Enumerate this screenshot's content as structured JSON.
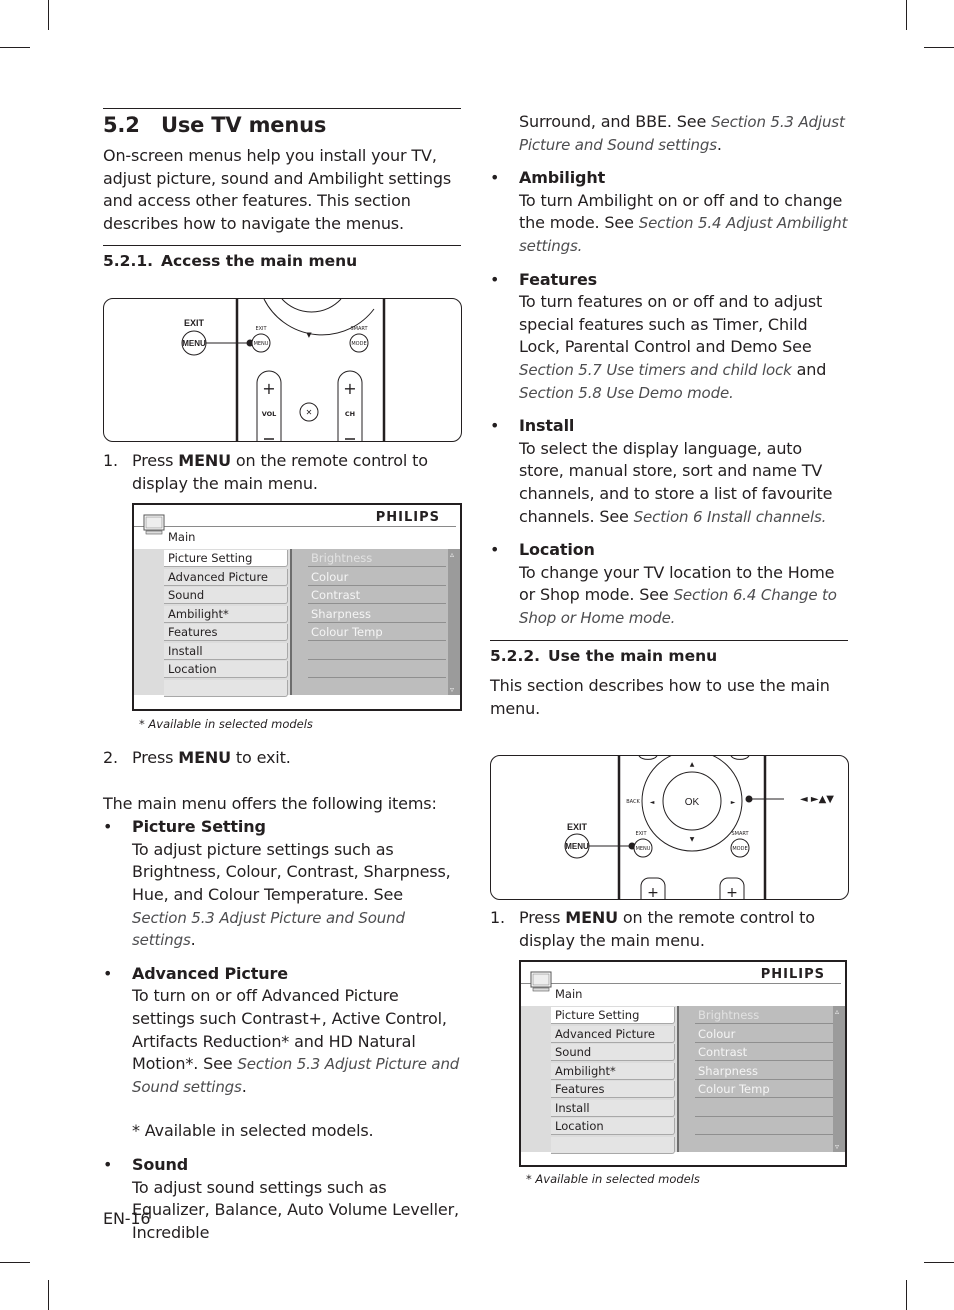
{
  "page": {
    "page_number": "EN-16"
  },
  "left_column": {
    "section_number": "5.2",
    "section_title": "Use TV menus",
    "intro": "On-screen menus help you install your TV, adjust picture, sound and Ambilight settings and access other features. This section describes how to navigate the menus.",
    "subsection_number": "5.2.1.",
    "subsection_title": "Access the main menu",
    "remote1": {
      "exit_label": "EXIT",
      "menu_label": "MENU",
      "small_exit": "EXIT",
      "small_menu": "MENU",
      "smart_label": "SMART",
      "mode_label": "MODE",
      "vol_label": "VOL",
      "ch_label": "CH",
      "plus": "+",
      "minus": "−"
    },
    "step1": {
      "num": "1.",
      "pre": "Press ",
      "key": "MENU",
      "post": " on the remote control to display the main menu."
    },
    "step2": {
      "num": "2.",
      "pre": "Press ",
      "key": "MENU",
      "post": " to exit."
    },
    "offers_intro": "The main menu offers the following items:",
    "items": [
      {
        "title": "Picture Setting",
        "text": "To adjust picture settings such as Brightness, Colour, Contrast, Sharpness, Hue, and Colour Temperature. See ",
        "ref": "Section 5.3 Adjust Picture and Sound settings",
        "tail": "."
      },
      {
        "title": "Advanced Picture",
        "text": "To turn on or off Advanced Picture settings such Contrast+, Active Control, Artifacts Reduction* and HD Natural Motion*. See ",
        "ref": "Section 5.3 Adjust Picture and Sound settings",
        "tail": ".",
        "note": "* Available in selected models."
      },
      {
        "title": "Sound",
        "text": "To adjust sound settings such as Equalizer, Balance, Auto Volume Leveller, Incredible"
      }
    ]
  },
  "right_column": {
    "sound_cont": "Surround, and BBE. See ",
    "sound_ref": "Section 5.3 Adjust Picture and Sound settings",
    "sound_tail": ".",
    "items": [
      {
        "title": "Ambilight",
        "text": "To turn Ambilight on or off and to change the mode. See ",
        "ref": "Section 5.4 Adjust Ambilight settings."
      },
      {
        "title": "Features",
        "text": "To turn features on or off and to adjust special features such as Timer, Child Lock, Parental Control and Demo See ",
        "ref": "Section 5.7 Use timers and child lock",
        "mid": " and ",
        "ref2": "Section 5.8 Use Demo mode."
      },
      {
        "title": "Install",
        "text": "To select the display language, auto store, manual store, sort and name TV channels, and to store a list of favourite channels. See ",
        "ref": "Section 6 Install channels."
      },
      {
        "title": "Location",
        "text": "To change your TV location to the Home or Shop mode. See ",
        "ref": "Section 6.4 Change to Shop or Home mode."
      }
    ],
    "subsection_number": "5.2.2.",
    "subsection_title": "Use the main menu",
    "intro": "This section describes how to use the main menu.",
    "remote2": {
      "exit_label": "EXIT",
      "menu_label": "MENU",
      "small_exit": "EXIT",
      "small_menu": "MENU",
      "smart_label": "SMART",
      "mode_label": "MODE",
      "back_label": "BACK",
      "ok_label": "OK",
      "arrows_label": "◄ ►▲▼",
      "plus": "+"
    },
    "step1": {
      "num": "1.",
      "pre": "Press ",
      "key": "MENU",
      "post": " on the remote control to display the main menu."
    }
  },
  "tv_menu": {
    "brand": "PHILIPS",
    "title": "Main",
    "left_items": [
      "Picture Setting",
      "Advanced Picture",
      "Sound",
      "Ambilight*",
      "Features",
      "Install",
      "Location",
      ""
    ],
    "selected_index": 0,
    "right_items": [
      "Brightness",
      "Colour",
      "Contrast",
      "Sharpness",
      "Colour Temp",
      "",
      "",
      ""
    ],
    "scroll_up": "▵",
    "scroll_down": "▿",
    "footnote": "* Available in selected models"
  }
}
